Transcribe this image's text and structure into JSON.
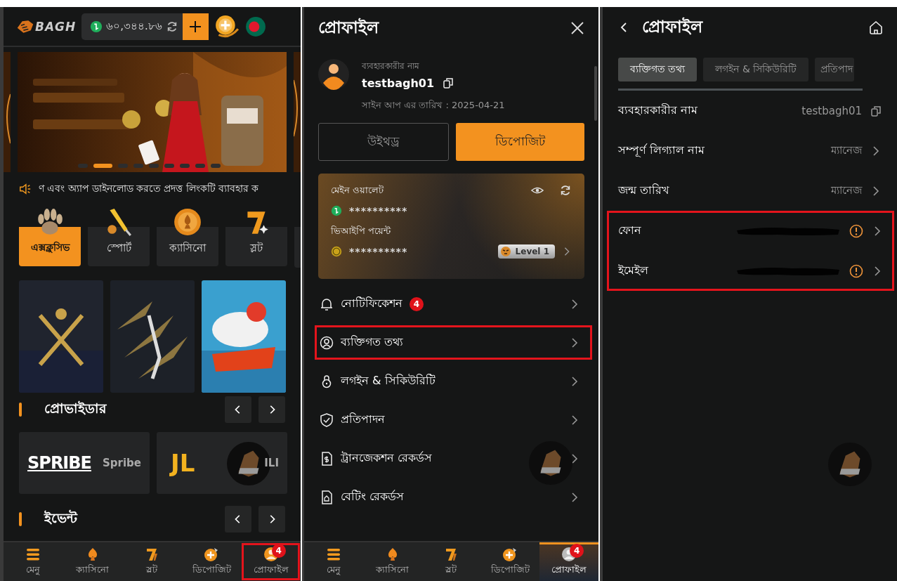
{
  "home": {
    "logo": "BAGH",
    "balance": "৬০,৩৪৪.৮৬",
    "banner": {
      "kind": "picture",
      "dots": [
        {
          "selected": false
        },
        {
          "selected": true
        },
        {
          "selected": false
        },
        {
          "selected": false
        },
        {
          "selected": false
        },
        {
          "selected": false
        },
        {
          "selected": false
        },
        {
          "selected": false
        },
        {
          "selected": false
        }
      ]
    },
    "marquee": "ণ এবং অ্যাপ ডাইনলোড করতে প্রদত্ত লিংকটি ব্যাবহার ক",
    "categories": [
      {
        "label": "এক্সক্লুসিভ",
        "selected": true
      },
      {
        "label": "স্পোর্ট",
        "selected": false
      },
      {
        "label": "ক্যাসিনো",
        "selected": false
      },
      {
        "label": "স্লট",
        "selected": false
      }
    ],
    "providers_title": "প্রোভাইডার",
    "providers": [
      {
        "logo": "SPRIBE",
        "name": "Spribe"
      },
      {
        "logo": "JL",
        "name": "ILI"
      }
    ],
    "events_title": "ইভেন্ট",
    "bottom_nav": [
      {
        "label": "মেনু",
        "selected": false,
        "highlighted": false
      },
      {
        "label": "ক্যাসিনো",
        "selected": false,
        "highlighted": false
      },
      {
        "label": "স্লট",
        "selected": false,
        "highlighted": false
      },
      {
        "label": "ডিপোজিট",
        "selected": false,
        "highlighted": false
      },
      {
        "label": "প্রোফাইল",
        "selected": false,
        "highlighted": true,
        "badge": "4"
      }
    ]
  },
  "profile_menu": {
    "title": "প্রোফাইল",
    "username_label": "ব্যবহারকারীর নাম",
    "username": "testbagh01",
    "signup": "সাইন আপ এর তারিখ : 2025-04-21",
    "withdraw": "উইথড্র",
    "deposit": "ডিপোজিট",
    "wallet": {
      "main_label": "মেইন ওয়ালেট",
      "main_value": "**********",
      "vip_label": "ভিআইপি পয়েন্ট",
      "vip_value": "**********",
      "vip_level": "Level 1"
    },
    "menu": [
      {
        "label": "নোটিফিকেশন",
        "badge": "4",
        "highlighted": false
      },
      {
        "label": "ব্যক্তিগত তথ্য",
        "highlighted": true
      },
      {
        "label": "লগইন & সিকিউরিটি",
        "highlighted": false
      },
      {
        "label": "প্রতিপাদন",
        "highlighted": false
      },
      {
        "label": "ট্রানজেকশন রেকর্ডস",
        "highlighted": false
      },
      {
        "label": "বেটিং রেকর্ডস",
        "highlighted": false
      }
    ],
    "bottom_nav": [
      {
        "label": "মেনু",
        "selected": false,
        "highlighted": false
      },
      {
        "label": "ক্যাসিনো",
        "selected": false,
        "highlighted": false
      },
      {
        "label": "স্লট",
        "selected": false,
        "highlighted": false
      },
      {
        "label": "ডিপোজিট",
        "selected": false,
        "highlighted": false
      },
      {
        "label": "প্রোফাইল",
        "selected": true,
        "highlighted": false,
        "badge": "4"
      }
    ]
  },
  "personal_info": {
    "title": "প্রোফাইল",
    "tabs": [
      {
        "label": "ব্যক্তিগত তথ্য",
        "selected": true
      },
      {
        "label": "লগইন & সিকিউরিটি",
        "selected": false
      },
      {
        "label": "প্রতিপাদ",
        "selected": false
      }
    ],
    "rows": [
      {
        "kind": "copy",
        "label": "ব্যবহারকারীর নাম",
        "value": "testbagh01",
        "highlighted": false
      },
      {
        "kind": "link",
        "label": "সম্পূর্ণ লিগ্যাল নাম",
        "value": "ম্যানেজ",
        "highlighted": false
      },
      {
        "kind": "link",
        "label": "জন্ম তারিখ",
        "value": "ম্যানেজ",
        "highlighted": false
      },
      {
        "kind": "redacted",
        "label": "ফোন",
        "highlighted": true
      },
      {
        "kind": "redacted",
        "label": "ইমেইল",
        "highlighted": true
      }
    ]
  }
}
